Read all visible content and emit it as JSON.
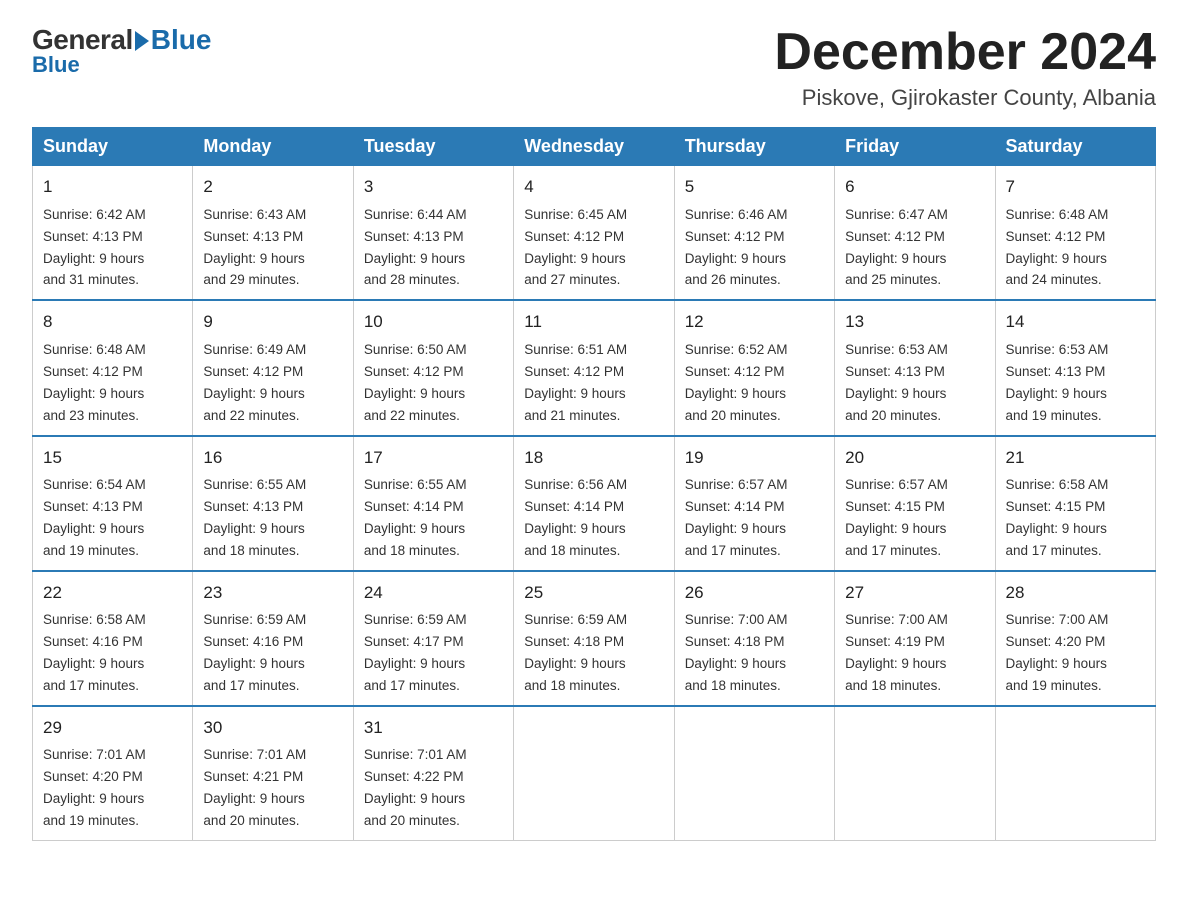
{
  "logo": {
    "general": "General",
    "blue": "Blue"
  },
  "title": {
    "month": "December 2024",
    "location": "Piskove, Gjirokaster County, Albania"
  },
  "headers": [
    "Sunday",
    "Monday",
    "Tuesday",
    "Wednesday",
    "Thursday",
    "Friday",
    "Saturday"
  ],
  "weeks": [
    [
      {
        "day": "1",
        "sunrise": "6:42 AM",
        "sunset": "4:13 PM",
        "daylight": "9 hours and 31 minutes."
      },
      {
        "day": "2",
        "sunrise": "6:43 AM",
        "sunset": "4:13 PM",
        "daylight": "9 hours and 29 minutes."
      },
      {
        "day": "3",
        "sunrise": "6:44 AM",
        "sunset": "4:13 PM",
        "daylight": "9 hours and 28 minutes."
      },
      {
        "day": "4",
        "sunrise": "6:45 AM",
        "sunset": "4:12 PM",
        "daylight": "9 hours and 27 minutes."
      },
      {
        "day": "5",
        "sunrise": "6:46 AM",
        "sunset": "4:12 PM",
        "daylight": "9 hours and 26 minutes."
      },
      {
        "day": "6",
        "sunrise": "6:47 AM",
        "sunset": "4:12 PM",
        "daylight": "9 hours and 25 minutes."
      },
      {
        "day": "7",
        "sunrise": "6:48 AM",
        "sunset": "4:12 PM",
        "daylight": "9 hours and 24 minutes."
      }
    ],
    [
      {
        "day": "8",
        "sunrise": "6:48 AM",
        "sunset": "4:12 PM",
        "daylight": "9 hours and 23 minutes."
      },
      {
        "day": "9",
        "sunrise": "6:49 AM",
        "sunset": "4:12 PM",
        "daylight": "9 hours and 22 minutes."
      },
      {
        "day": "10",
        "sunrise": "6:50 AM",
        "sunset": "4:12 PM",
        "daylight": "9 hours and 22 minutes."
      },
      {
        "day": "11",
        "sunrise": "6:51 AM",
        "sunset": "4:12 PM",
        "daylight": "9 hours and 21 minutes."
      },
      {
        "day": "12",
        "sunrise": "6:52 AM",
        "sunset": "4:12 PM",
        "daylight": "9 hours and 20 minutes."
      },
      {
        "day": "13",
        "sunrise": "6:53 AM",
        "sunset": "4:13 PM",
        "daylight": "9 hours and 20 minutes."
      },
      {
        "day": "14",
        "sunrise": "6:53 AM",
        "sunset": "4:13 PM",
        "daylight": "9 hours and 19 minutes."
      }
    ],
    [
      {
        "day": "15",
        "sunrise": "6:54 AM",
        "sunset": "4:13 PM",
        "daylight": "9 hours and 19 minutes."
      },
      {
        "day": "16",
        "sunrise": "6:55 AM",
        "sunset": "4:13 PM",
        "daylight": "9 hours and 18 minutes."
      },
      {
        "day": "17",
        "sunrise": "6:55 AM",
        "sunset": "4:14 PM",
        "daylight": "9 hours and 18 minutes."
      },
      {
        "day": "18",
        "sunrise": "6:56 AM",
        "sunset": "4:14 PM",
        "daylight": "9 hours and 18 minutes."
      },
      {
        "day": "19",
        "sunrise": "6:57 AM",
        "sunset": "4:14 PM",
        "daylight": "9 hours and 17 minutes."
      },
      {
        "day": "20",
        "sunrise": "6:57 AM",
        "sunset": "4:15 PM",
        "daylight": "9 hours and 17 minutes."
      },
      {
        "day": "21",
        "sunrise": "6:58 AM",
        "sunset": "4:15 PM",
        "daylight": "9 hours and 17 minutes."
      }
    ],
    [
      {
        "day": "22",
        "sunrise": "6:58 AM",
        "sunset": "4:16 PM",
        "daylight": "9 hours and 17 minutes."
      },
      {
        "day": "23",
        "sunrise": "6:59 AM",
        "sunset": "4:16 PM",
        "daylight": "9 hours and 17 minutes."
      },
      {
        "day": "24",
        "sunrise": "6:59 AM",
        "sunset": "4:17 PM",
        "daylight": "9 hours and 17 minutes."
      },
      {
        "day": "25",
        "sunrise": "6:59 AM",
        "sunset": "4:18 PM",
        "daylight": "9 hours and 18 minutes."
      },
      {
        "day": "26",
        "sunrise": "7:00 AM",
        "sunset": "4:18 PM",
        "daylight": "9 hours and 18 minutes."
      },
      {
        "day": "27",
        "sunrise": "7:00 AM",
        "sunset": "4:19 PM",
        "daylight": "9 hours and 18 minutes."
      },
      {
        "day": "28",
        "sunrise": "7:00 AM",
        "sunset": "4:20 PM",
        "daylight": "9 hours and 19 minutes."
      }
    ],
    [
      {
        "day": "29",
        "sunrise": "7:01 AM",
        "sunset": "4:20 PM",
        "daylight": "9 hours and 19 minutes."
      },
      {
        "day": "30",
        "sunrise": "7:01 AM",
        "sunset": "4:21 PM",
        "daylight": "9 hours and 20 minutes."
      },
      {
        "day": "31",
        "sunrise": "7:01 AM",
        "sunset": "4:22 PM",
        "daylight": "9 hours and 20 minutes."
      },
      null,
      null,
      null,
      null
    ]
  ],
  "labels": {
    "sunrise": "Sunrise:",
    "sunset": "Sunset:",
    "daylight": "Daylight:"
  }
}
